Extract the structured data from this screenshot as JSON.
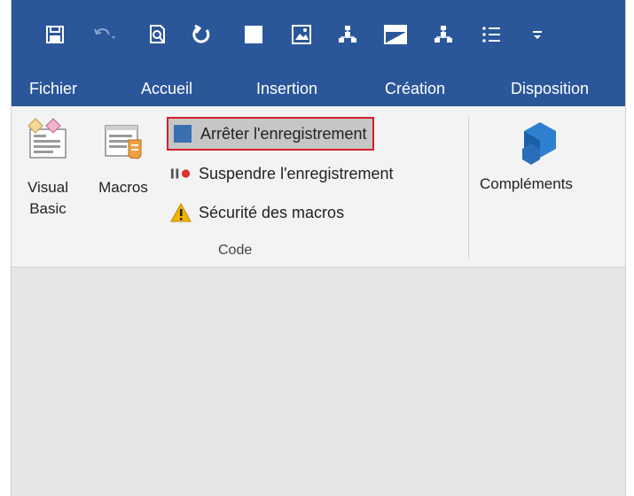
{
  "quick_access": {
    "icons": [
      "save-icon",
      "undo-icon",
      "print-preview-icon",
      "redo-icon",
      "stop-square-icon",
      "picture-icon",
      "org-chart-icon",
      "window-icon",
      "org-chart-icon",
      "list-icon",
      "customize-arrow-icon"
    ]
  },
  "tabs": [
    {
      "label": "Fichier"
    },
    {
      "label": "Accueil"
    },
    {
      "label": "Insertion"
    },
    {
      "label": "Création"
    },
    {
      "label": "Disposition"
    }
  ],
  "ribbon": {
    "visual_basic": {
      "line1": "Visual",
      "line2": "Basic"
    },
    "macros": {
      "label": "Macros"
    },
    "stop_recording": {
      "label": "Arrêter l'enregistrement"
    },
    "pause_recording": {
      "label": "Suspendre l'enregistrement"
    },
    "macro_security": {
      "label": "Sécurité des macros"
    },
    "group_label": "Code",
    "addins": {
      "label": "Compléments"
    }
  },
  "colors": {
    "title_bar": "#2b579a",
    "ribbon_bg": "#f3f3f3",
    "highlight_border": "#d4202c",
    "stop_square": "#3a6fb0",
    "record_dot": "#d9322a",
    "warning": "#f0b400"
  }
}
